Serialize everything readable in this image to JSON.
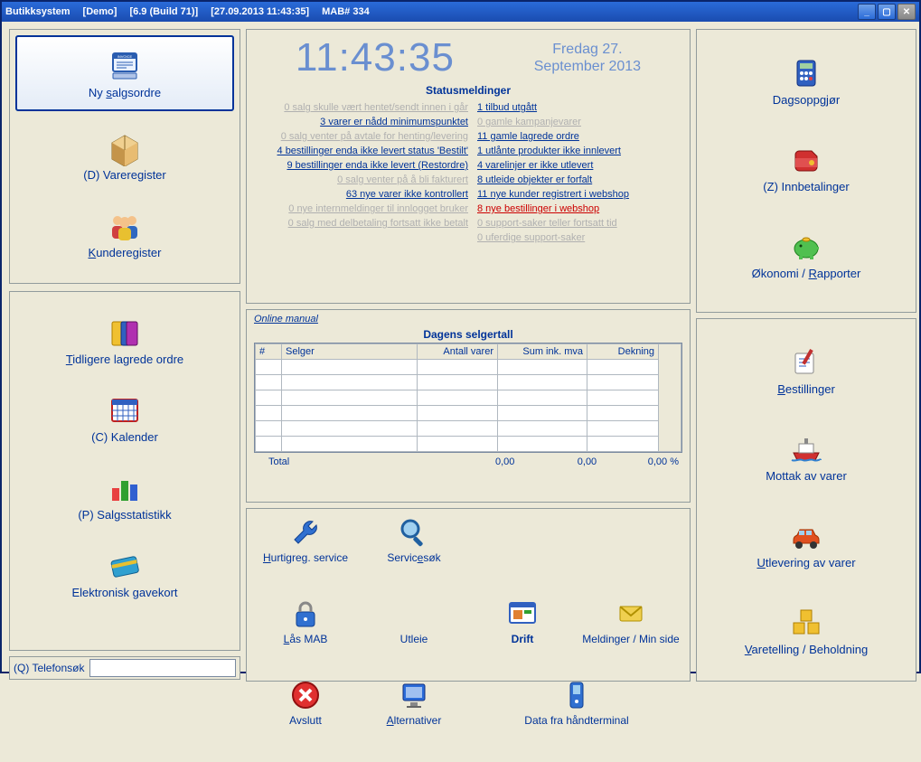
{
  "titlebar": {
    "app": "Butikksystem",
    "demo": "[Demo]",
    "build": "[6.9 (Build 71)]",
    "date": "[27.09.2013  11:43:35]",
    "mab": "MAB# 334"
  },
  "left": {
    "new_order": "Ny salgsordre",
    "items": "(D) Vareregister",
    "customers": "Kunderegister",
    "saved_orders": "Tidligere lagrede ordre",
    "calendar": "(C) Kalender",
    "stats": "(P) Salgsstatistikk",
    "giftcard": "Elektronisk gavekort",
    "phone_label": "(Q) Telefonsøk",
    "phone_value": ""
  },
  "center": {
    "clock": "11:43:35",
    "date_l1": "Fredag 27.",
    "date_l2": "September 2013",
    "status_hdr": "Statusmeldinger",
    "status_left": [
      {
        "t": "0 salg skulle vært hentet/sendt innen i går",
        "dim": true
      },
      {
        "t": "3 varer er nådd minimumspunktet",
        "dim": false
      },
      {
        "t": "0 salg venter på avtale for henting/levering",
        "dim": true
      },
      {
        "t": "4 bestillinger enda ikke levert status 'Bestilt'",
        "dim": false
      },
      {
        "t": "9 bestillinger enda ikke levert (Restordre)",
        "dim": false
      },
      {
        "t": "0 salg venter på å bli fakturert",
        "dim": true
      },
      {
        "t": "63 nye varer ikke kontrollert",
        "dim": false
      },
      {
        "t": "0 nye internmeldinger til innlogget bruker",
        "dim": true
      },
      {
        "t": "0 salg med delbetaling fortsatt ikke betalt",
        "dim": true
      }
    ],
    "status_right": [
      {
        "t": "1 tilbud utgått",
        "dim": false
      },
      {
        "t": "0 gamle kampanjevarer",
        "dim": true
      },
      {
        "t": "11 gamle lagrede ordre",
        "dim": false
      },
      {
        "t": "1 utlånte produkter ikke innlevert",
        "dim": false
      },
      {
        "t": "4 varelinjer er ikke utlevert",
        "dim": false
      },
      {
        "t": "8 utleide objekter er forfalt",
        "dim": false
      },
      {
        "t": "11 nye kunder registrert i webshop",
        "dim": false
      },
      {
        "t": "8 nye bestillinger i webshop",
        "red": true
      },
      {
        "t": "0 support-saker teller fortsatt tid",
        "dim": true
      },
      {
        "t": "0 uferdige support-saker",
        "dim": true
      }
    ],
    "online_manual": "Online manual",
    "table_hdr": "Dagens selgertall",
    "cols": {
      "n": "#",
      "seller": "Selger",
      "qty": "Antall varer",
      "sum": "Sum ink. mva",
      "cov": "Dekning"
    },
    "total": {
      "label": "Total",
      "qty": "0,00",
      "sum": "0,00",
      "cov": "0,00 %"
    },
    "tools": {
      "svc_reg": "Hurtigreg. service",
      "svc_search": "Servicesøk",
      "lock": "Lås MAB",
      "rental": "Utleie",
      "drift": "Drift",
      "msgs": "Meldinger / Min side",
      "exit": "Avslutt",
      "options": "Alternativer",
      "handterm": "Data fra håndterminal"
    }
  },
  "right": {
    "dayclose": "Dagsoppgjør",
    "payments": "(Z) Innbetalinger",
    "economy": "Økonomi / Rapporter",
    "orders": "Bestillinger",
    "receive": "Mottak av varer",
    "deliver": "Utlevering av varer",
    "stock": "Varetelling / Beholdning"
  }
}
